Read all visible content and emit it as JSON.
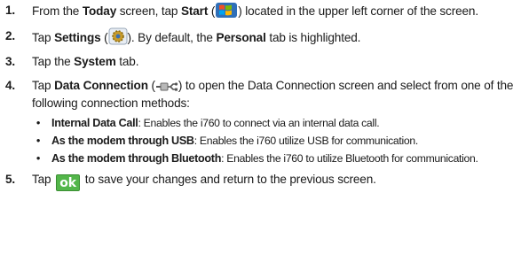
{
  "steps": [
    {
      "num": "1.",
      "t1": "From the ",
      "b1": "Today",
      "t2": " screen, tap ",
      "b2": "Start",
      "t3": " (",
      "t4": ") located in the upper left corner of the screen."
    },
    {
      "num": "2.",
      "t1": "Tap ",
      "b1": "Settings",
      "t2": " (",
      "t3": "). By default, the ",
      "b2": "Personal",
      "t4": " tab is highlighted."
    },
    {
      "num": "3.",
      "t1": "Tap the ",
      "b1": "System",
      "t2": " tab."
    },
    {
      "num": "4.",
      "t1": "Tap ",
      "b1": "Data Connection",
      "t2": " (",
      "t3": ") to open the Data Connection screen and select from one of the following connection methods:"
    },
    {
      "num": "5.",
      "t1": "Tap ",
      "t2": " to save your changes and return to the previous screen."
    }
  ],
  "bullets": [
    {
      "dot": "•",
      "term": "Internal Data Call",
      "desc": ": Enables the i760 to connect via an internal data call."
    },
    {
      "dot": "•",
      "term": "As the modem through USB",
      "desc": ": Enables the i760 utilize USB for communication."
    },
    {
      "dot": "•",
      "term": "As the modem through Bluetooth",
      "desc": ": Enables the i760  to utilize Bluetooth for communication."
    }
  ],
  "ok_label": "ok",
  "icons": {
    "start": "windows-start-icon",
    "settings": "settings-gear-icon",
    "data_connection": "usb-plug-icon",
    "ok": "ok-button-icon"
  },
  "colors": {
    "ok_green": "#53b64a"
  }
}
